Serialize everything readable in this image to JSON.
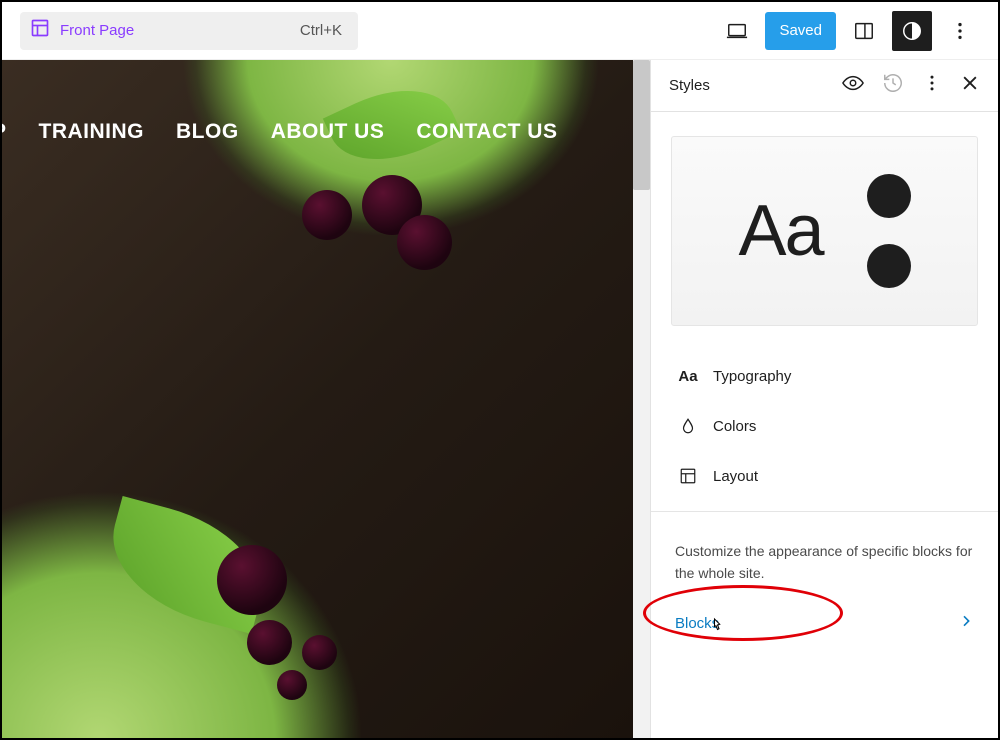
{
  "topbar": {
    "page_label": "Front Page",
    "shortcut": "Ctrl+K",
    "saved_label": "Saved"
  },
  "nav": {
    "items": [
      "P",
      "TRAINING",
      "BLOG",
      "ABOUT US",
      "CONTACT US"
    ]
  },
  "sidebar": {
    "title": "Styles",
    "preview": "Aa",
    "menu": {
      "typography": "Typography",
      "colors": "Colors",
      "layout": "Layout"
    },
    "blocks_desc": "Customize the appearance of specific blocks for the whole site.",
    "blocks_label": "Blocks"
  }
}
